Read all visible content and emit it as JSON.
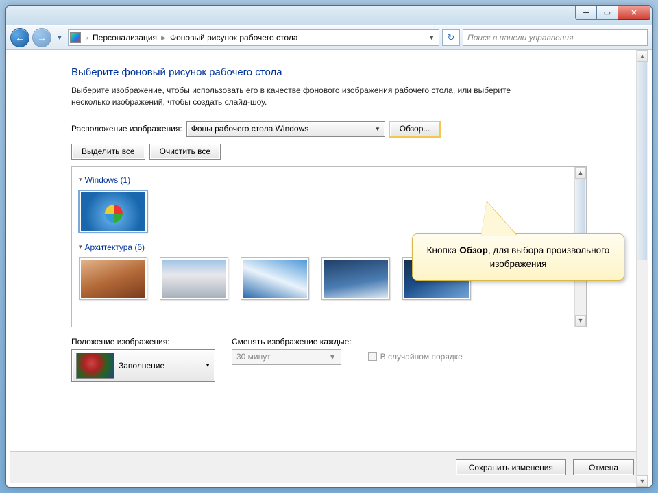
{
  "breadcrumb": {
    "parent": "Персонализация",
    "current": "Фоновый рисунок рабочего стола"
  },
  "search": {
    "placeholder": "Поиск в панели управления"
  },
  "heading": "Выберите фоновый рисунок рабочего стола",
  "description": "Выберите изображение, чтобы использовать его в качестве фонового изображения рабочего стола, или выберите несколько изображений, чтобы создать слайд-шоу.",
  "locationLabel": "Расположение изображения:",
  "locationValue": "Фоны рабочего стола Windows",
  "browse": "Обзор...",
  "selectAll": "Выделить все",
  "clearAll": "Очистить все",
  "groups": {
    "g1": "Windows (1)",
    "g2": "Архитектура (6)"
  },
  "position": {
    "label": "Положение изображения:",
    "value": "Заполнение"
  },
  "interval": {
    "label": "Сменять изображение каждые:",
    "value": "30 минут"
  },
  "random": "В случайном порядке",
  "save": "Сохранить изменения",
  "cancel": "Отмена",
  "callout": {
    "pre": "Кнопка ",
    "bold": "Обзор",
    "post": ", для выбора произвольного изображения"
  }
}
